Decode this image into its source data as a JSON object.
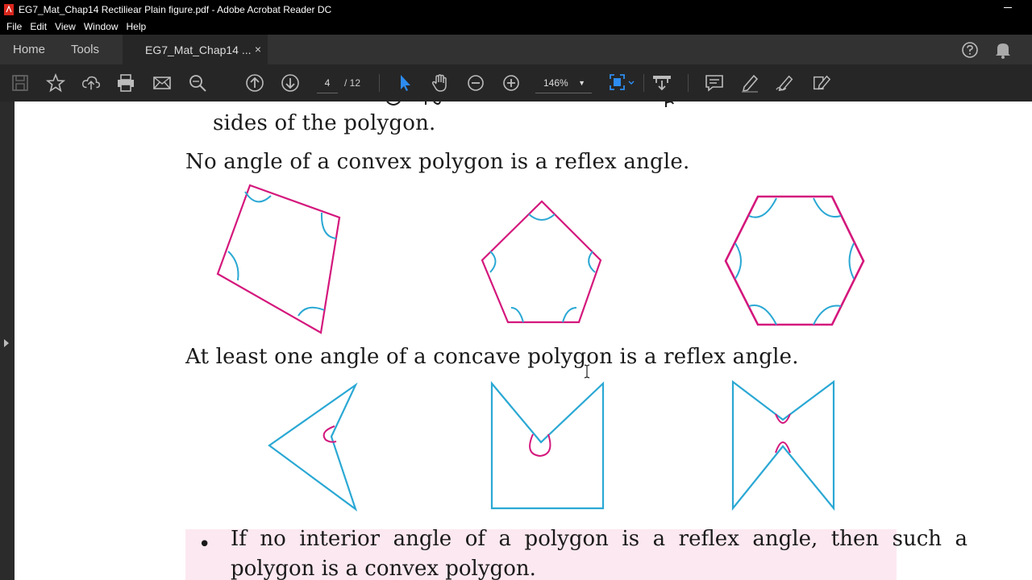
{
  "window": {
    "title": "EG7_Mat_Chap14 Rectiliear Plain figure.pdf - Adobe Acrobat Reader DC"
  },
  "menu": [
    "File",
    "Edit",
    "View",
    "Window",
    "Help"
  ],
  "tabs": {
    "home": "Home",
    "tools": "Tools",
    "document": "EG7_Mat_Chap14 ...",
    "close": "×"
  },
  "toolbar": {
    "page_current": "4",
    "page_total": "/ 12",
    "zoom": "146%"
  },
  "icons": {
    "save": "save-icon",
    "bookmark": "star-icon",
    "upload": "cloud-upload-icon",
    "print": "printer-icon",
    "email": "envelope-icon",
    "search": "magnify-icon",
    "prev": "arrow-up-circle-icon",
    "next": "arrow-down-circle-icon",
    "select": "pointer-icon",
    "hand": "hand-icon",
    "zoom_out": "minus-circle-icon",
    "zoom_in": "plus-circle-icon",
    "fit": "fit-page-icon",
    "scroll": "scroll-mode-icon",
    "comment": "comment-icon",
    "highlight": "pen-icon",
    "sign": "sign-icon",
    "stamp": "edit-stamp-icon",
    "help": "help-icon",
    "bell": "bell-icon",
    "share": "share-user-icon"
  },
  "colors": {
    "convex_stroke": "#d4177c",
    "concave_stroke": "#2aa8d4",
    "accent": "#1473e6",
    "callout_bg": "#fce8f0"
  },
  "document": {
    "line_top": "sides of the polygon.",
    "convex_statement": "No angle of a convex polygon is a reflex angle.",
    "concave_statement": "At least one angle of a concave polygon is a reflex angle.",
    "callout_line1": "If  no  interior  angle  of  a  polygon  is  a  reflex  angle,  then  such  a",
    "callout_line2": "polygon is a convex polygon.",
    "bullet": "•"
  }
}
